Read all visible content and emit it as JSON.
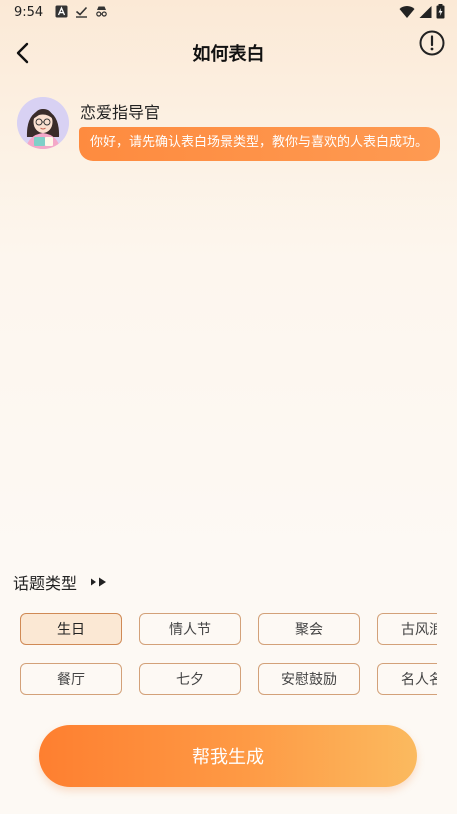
{
  "status_bar": {
    "time": "9:54",
    "left_icons": [
      "a-square-icon",
      "check-icon",
      "incognito-icon"
    ],
    "right_icons": [
      "wifi-icon",
      "signal-icon",
      "battery-icon"
    ]
  },
  "header": {
    "title": "如何表白",
    "back_icon": "chevron-left-icon",
    "info_icon": "exclamation-circle-icon"
  },
  "chat": {
    "bot_name": "恋爱指导官",
    "message": "你好，请先确认表白场景类型，教你与喜欢的人表白成功。"
  },
  "topics": {
    "title": "话题类型",
    "chips_row1": [
      "生日",
      "情人节",
      "聚会",
      "古风浪"
    ],
    "chips_row2": [
      "餐厅",
      "七夕",
      "安慰鼓励",
      "名人名"
    ],
    "selected": "生日"
  },
  "generate_label": "帮我生成",
  "colors": {
    "accent": "#fe8b3f",
    "chip_border": "#d3a179",
    "chip_selected_bg": "#fbe8d4"
  }
}
